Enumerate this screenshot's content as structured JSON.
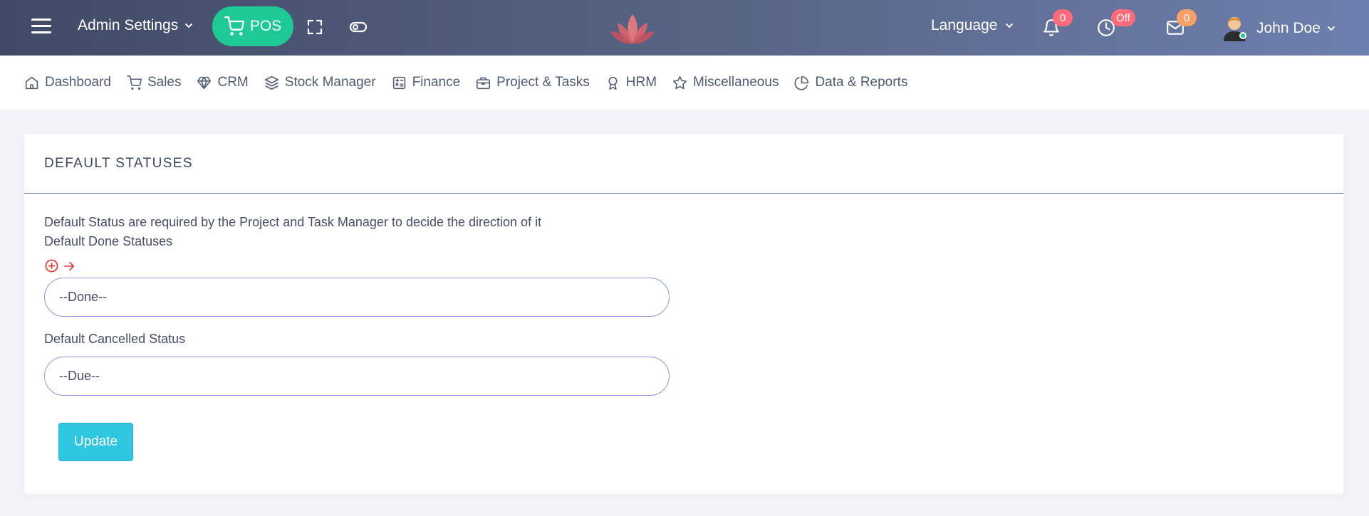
{
  "header": {
    "admin_settings_label": "Admin Settings",
    "pos_label": "POS",
    "language_label": "Language",
    "notifications_count": "0",
    "clock_status": "Off",
    "messages_count": "0",
    "user_name": "John Doe"
  },
  "nav": {
    "items": [
      {
        "label": "Dashboard",
        "icon": "home-icon"
      },
      {
        "label": "Sales",
        "icon": "cart-icon"
      },
      {
        "label": "CRM",
        "icon": "diamond-icon"
      },
      {
        "label": "Stock Manager",
        "icon": "layers-icon"
      },
      {
        "label": "Finance",
        "icon": "calculator-icon"
      },
      {
        "label": "Project & Tasks",
        "icon": "briefcase-icon"
      },
      {
        "label": "HRM",
        "icon": "award-icon"
      },
      {
        "label": "Miscellaneous",
        "icon": "star-icon"
      },
      {
        "label": "Data & Reports",
        "icon": "pie-chart-icon"
      }
    ]
  },
  "card": {
    "title": "DEFAULT STATUSES",
    "description": "Default Status are required by the Project and Task Manager to decide the direction of it",
    "done_label": "Default Done Statuses",
    "done_value": "--Done--",
    "cancelled_label": "Default Cancelled Status",
    "cancelled_value": "--Due--",
    "update_label": "Update"
  },
  "colors": {
    "accent_green": "#1fc995",
    "badge_red": "#ff6b7a",
    "badge_orange": "#f7a169",
    "update_button": "#2ec6e0",
    "action_red": "#e53935"
  }
}
